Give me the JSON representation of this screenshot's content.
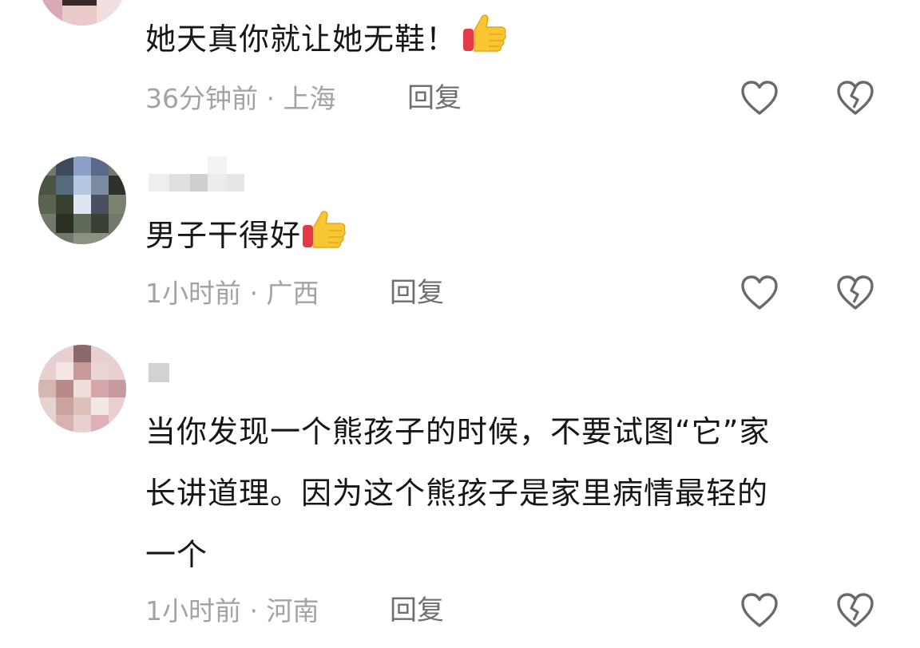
{
  "comments": [
    {
      "text": "她天真你就让她无鞋！",
      "emoji": "thumbs-up-icon",
      "time": "36分钟前",
      "location": "上海",
      "reply_label": "回复"
    },
    {
      "text": "男子干得好",
      "emoji": "thumbs-up-icon",
      "time": "1小时前",
      "location": "广西",
      "reply_label": "回复"
    },
    {
      "text_lines": [
        "当你发现一个熊孩子的时候，不要试图“它”家",
        "长讲道理。因为这个熊孩子是家里病情最轻的",
        "一个"
      ],
      "time": "1小时前",
      "location": "河南",
      "reply_label": "回复"
    }
  ],
  "meta_separator": "·",
  "colors": {
    "meta_text": "#a3a3a3",
    "reply_text": "#6f6f6f",
    "icon_stroke": "#6a6a6a",
    "body_text": "#161616"
  }
}
